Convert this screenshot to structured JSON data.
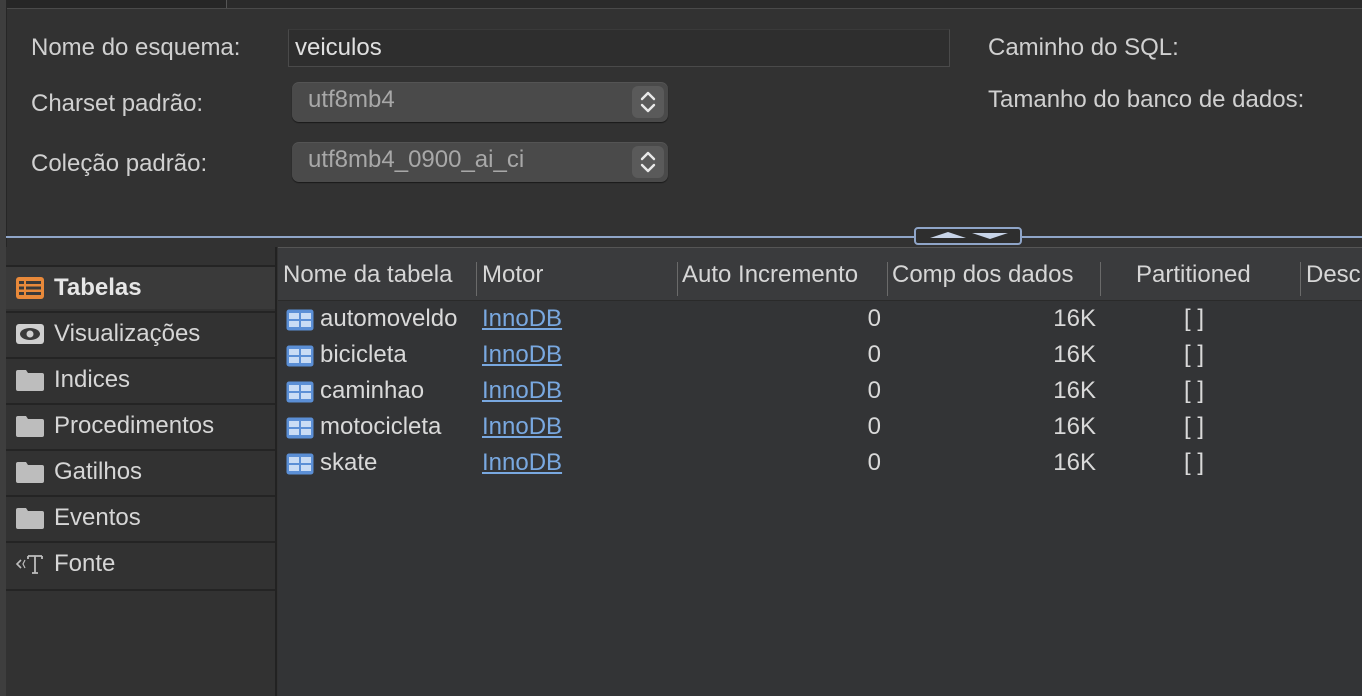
{
  "schema_form": {
    "name_label": "Nome do esquema:",
    "name_value": "veiculos",
    "charset_label": "Charset padrão:",
    "charset_value": "utf8mb4",
    "collation_label": "Coleção padrão:",
    "collation_value": "utf8mb4_0900_ai_ci",
    "sql_path_label": "Caminho do SQL:",
    "db_size_label": "Tamanho do banco de dados:"
  },
  "sidebar": {
    "items": [
      {
        "label": "Tabelas",
        "icon": "table-list-icon",
        "selected": true
      },
      {
        "label": "Visualizações",
        "icon": "eye-icon"
      },
      {
        "label": "Indices",
        "icon": "folder-icon"
      },
      {
        "label": "Procedimentos",
        "icon": "folder-icon"
      },
      {
        "label": "Gatilhos",
        "icon": "folder-icon"
      },
      {
        "label": "Eventos",
        "icon": "folder-icon"
      },
      {
        "label": "Fonte",
        "icon": "source-text-icon"
      }
    ]
  },
  "table": {
    "columns": [
      "Nome da tabela",
      "Motor",
      "Auto Incremento",
      "Comp dos dados",
      "Partitioned",
      "Desc"
    ],
    "rows": [
      {
        "name": "automoveldo",
        "engine": "InnoDB",
        "auto_inc": "0",
        "data_len": "16K",
        "partitioned": "[ ]"
      },
      {
        "name": "bicicleta",
        "engine": "InnoDB",
        "auto_inc": "0",
        "data_len": "16K",
        "partitioned": "[ ]"
      },
      {
        "name": "caminhao",
        "engine": "InnoDB",
        "auto_inc": "0",
        "data_len": "16K",
        "partitioned": "[ ]"
      },
      {
        "name": "motocicleta",
        "engine": "InnoDB",
        "auto_inc": "0",
        "data_len": "16K",
        "partitioned": "[ ]"
      },
      {
        "name": "skate",
        "engine": "InnoDB",
        "auto_inc": "0",
        "data_len": "16K",
        "partitioned": "[ ]"
      }
    ]
  },
  "colors": {
    "background": "#323232",
    "accent_splitter": "#8fa5c8",
    "link": "#79a8e0",
    "table_icon": "#5b8fd6",
    "selected_icon": "#e8893a"
  }
}
